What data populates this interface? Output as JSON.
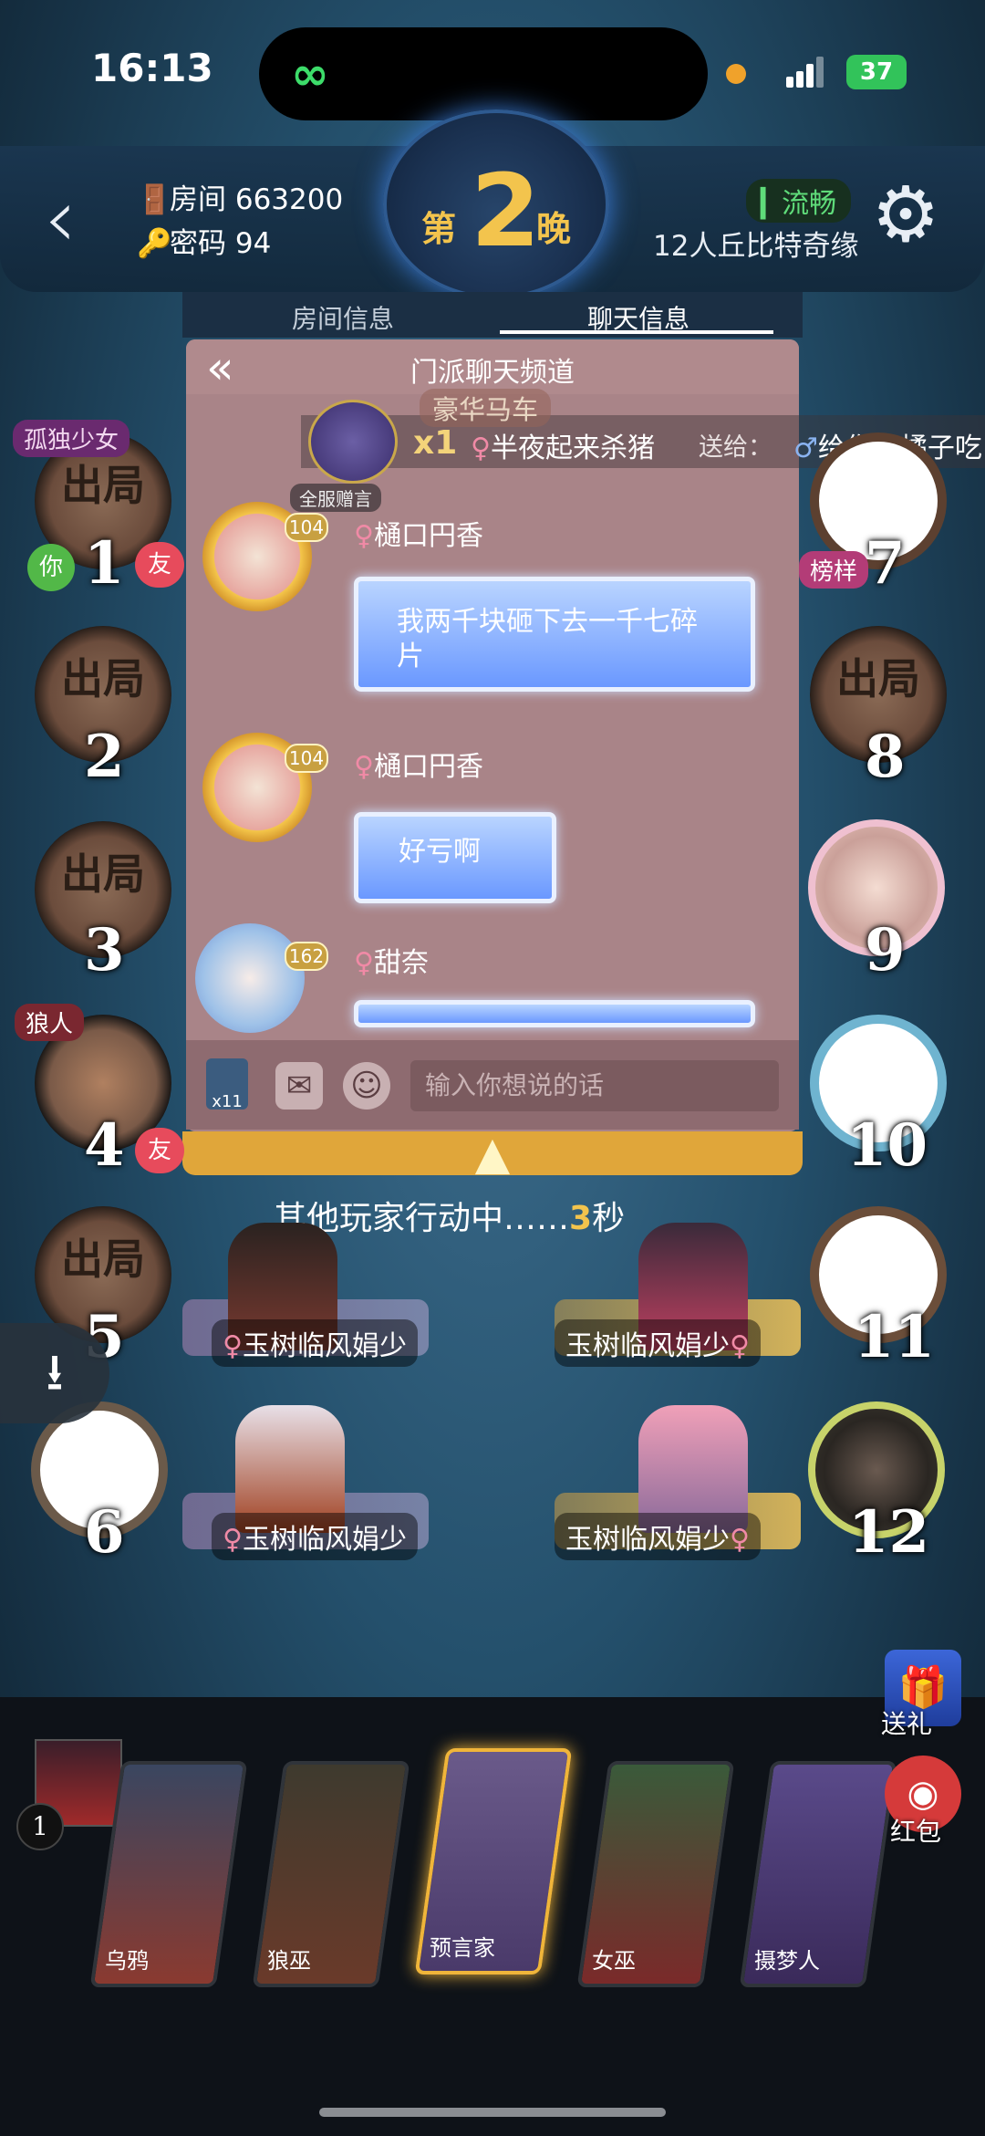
{
  "status": {
    "time": "16:13",
    "battery": "37"
  },
  "header": {
    "room": "房间 663200",
    "password": "密码 94",
    "night_prefix": "第",
    "night_num": "2",
    "night_suffix": "晚",
    "network": "流畅",
    "mode": "12人丘比特奇缘"
  },
  "chat": {
    "tab_room": "房间信息",
    "tab_chat": "聊天信息",
    "title": "门派聊天频道",
    "gift_banner": {
      "gift_name": "豪华马车",
      "count": "x1",
      "from": "半夜起来杀猪",
      "to_label": "送给：",
      "to": "给你买橘子吃",
      "broadcast": "全服赠言"
    },
    "messages": [
      {
        "level": "104",
        "name": "樋口円香",
        "text": "我两千块砸下去一千七碎片"
      },
      {
        "level": "104",
        "name": "樋口円香",
        "text": "好亏啊"
      },
      {
        "level": "162",
        "name": "甜奈",
        "text": ""
      }
    ],
    "bag_count": "x11",
    "input_placeholder": "输入你想说的话"
  },
  "seats": {
    "s1": {
      "num": "1",
      "title": "孤独少女",
      "you": "你",
      "friend": "友",
      "word": "出局"
    },
    "s2": {
      "num": "2",
      "word": "出局"
    },
    "s3": {
      "num": "3",
      "word": "出局"
    },
    "s4": {
      "num": "4",
      "role": "狼人",
      "friend": "友"
    },
    "s5": {
      "num": "5",
      "word": "出局"
    },
    "s6": {
      "num": "6"
    },
    "s7": {
      "num": "7",
      "badge": "榜样"
    },
    "s8": {
      "num": "8",
      "word": "出局"
    },
    "s9": {
      "num": "9"
    },
    "s10": {
      "num": "10"
    },
    "s11": {
      "num": "11"
    },
    "s12": {
      "num": "12"
    }
  },
  "action": {
    "text": "其他玩家行动中……",
    "seconds": "3",
    "unit": "秒"
  },
  "player_names": [
    "玉树临风娟少",
    "玉树临风娟少",
    "玉树临风娟少",
    "玉树临风娟少"
  ],
  "bottom": {
    "player_num": "1",
    "cards": [
      "乌鸦",
      "狼巫",
      "预言家",
      "女巫",
      "摄梦人"
    ],
    "gift": "送礼",
    "redpack": "红包"
  }
}
